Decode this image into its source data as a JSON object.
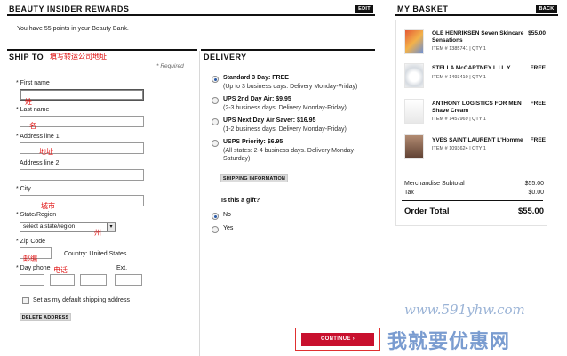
{
  "rewards": {
    "title": "BEAUTY INSIDER REWARDS",
    "edit_label": "EDIT",
    "points_text": "You have 55 points in your Beauty Bank."
  },
  "ship_to": {
    "title": "SHIP TO",
    "title_note": "填写转运公司地址",
    "required": "* Required",
    "first_name_label": "* First name",
    "first_name_note": "姓",
    "last_name_label": "* Last name",
    "last_name_note": "名",
    "address1_label": "* Address line 1",
    "address1_note": "地址",
    "address2_label": "Address line 2",
    "city_label": "* City",
    "city_note": "城市",
    "state_label": "* State/Region",
    "state_value": "select a state/region",
    "state_note": "州",
    "zip_label": "* Zip Code",
    "zip_note": "邮编",
    "country_text": "Country: United States",
    "phone_label": "* Day phone",
    "phone_note": "电话",
    "ext_label": "Ext.",
    "default_checkbox_label": "Set as my default shipping address",
    "delete_label": "DELETE ADDRESS"
  },
  "delivery": {
    "title": "DELIVERY",
    "options": [
      {
        "title": "Standard 3 Day: FREE",
        "sub": "(Up to 3 business days. Delivery Monday-Friday)",
        "checked": true
      },
      {
        "title": "UPS 2nd Day Air: $9.95",
        "sub": "(2-3 business days. Delivery Monday-Friday)",
        "checked": false
      },
      {
        "title": "UPS Next Day Air Saver: $16.95",
        "sub": "(1-2 business days. Delivery Monday-Friday)",
        "checked": false
      },
      {
        "title": "USPS Priority: $6.95",
        "sub": "(All states: 2-4 business days. Delivery Monday-",
        "sub2": "Saturday)",
        "checked": false
      }
    ],
    "shipping_info_label": "SHIPPING INFORMATION",
    "gift_question": "Is this a gift?",
    "gift_no": "No",
    "gift_yes": "Yes",
    "continue_label": "CONTINUE ›"
  },
  "basket": {
    "title": "MY BASKET",
    "back_label": "BACK",
    "items": [
      {
        "name1": "OLE HENRIKSEN Seven Skincare",
        "name2": "Sensations",
        "meta": "ITEM # 1385741  |  QTY 1",
        "price": "$55.00",
        "thumb_color": "#d9452b"
      },
      {
        "name1": "STELLA McCARTNEY L.I.L.Y",
        "name2": "",
        "meta": "ITEM # 1493410  |  QTY 1",
        "price": "FREE",
        "thumb_color": "#d8dde3"
      },
      {
        "name1": "ANTHONY LOGISTICS FOR MEN",
        "name2": "Shave Cream",
        "meta": "ITEM # 1457969  |  QTY 1",
        "price": "FREE",
        "thumb_color": "#e9e9e9"
      },
      {
        "name1": "YVES SAINT LAURENT L'Homme",
        "name2": "",
        "meta": "ITEM # 1093624  |  QTY 1",
        "price": "FREE",
        "thumb_color": "#7a5a4a"
      }
    ],
    "subtotal_label": "Merchandise Subtotal",
    "subtotal_value": "$55.00",
    "tax_label": "Tax",
    "tax_value": "$0.00",
    "total_label": "Order Total",
    "total_value": "$55.00"
  },
  "watermark": {
    "url": "www.591yhw.com",
    "text": "我就要优惠网"
  }
}
